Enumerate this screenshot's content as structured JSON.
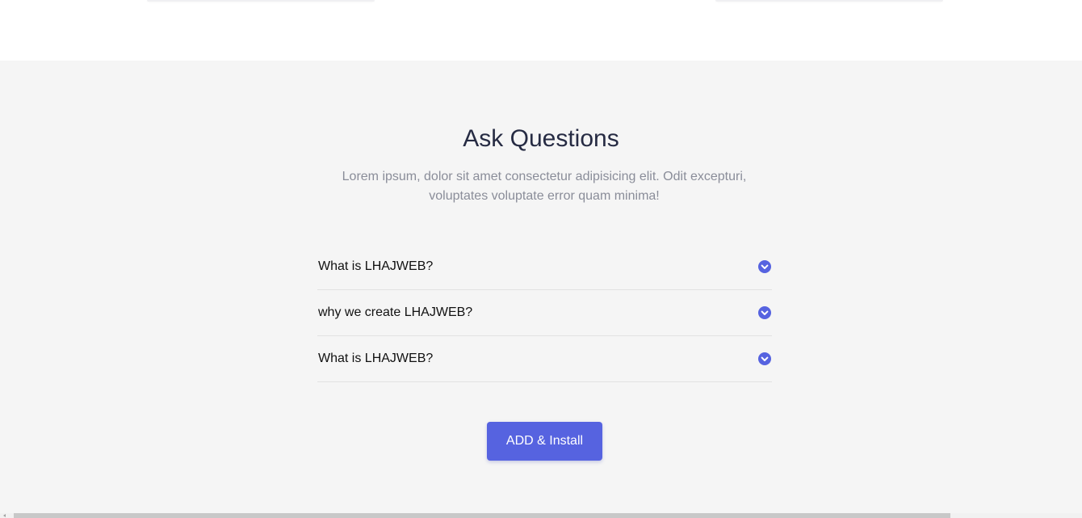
{
  "faq": {
    "title": "Ask Questions",
    "subtitle": "Lorem ipsum, dolor sit amet consectetur adipisicing elit. Odit excepturi, voluptates voluptate error quam minima!",
    "items": [
      {
        "question": "What is LHAJWEB?",
        "icon": "chevron-down-circle-icon"
      },
      {
        "question": "why we create LHAJWEB?",
        "icon": "chevron-down-circle-icon"
      },
      {
        "question": "What is LHAJWEB?",
        "icon": "chevron-down-circle-icon"
      }
    ],
    "button_label": "ADD & Install"
  },
  "colors": {
    "accent": "#5663e0",
    "section_bg": "#f5f5f5",
    "title": "#262b43",
    "subtitle": "#8a8d99"
  }
}
